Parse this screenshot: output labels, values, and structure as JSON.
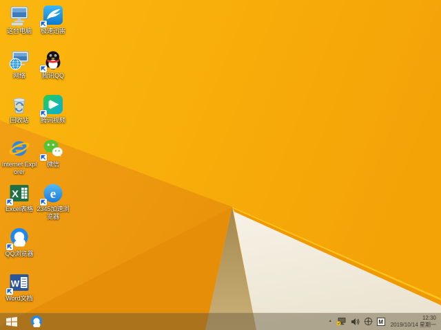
{
  "wallpaper": {
    "base_color": "#F8AF0B",
    "fold_mid_orange": "#F0990C",
    "fold_dark_orange": "#E78E08",
    "tan_triangle_top": "#A3874E",
    "tan_triangle_bottom": "#CBB179",
    "white_triangle_top": "#F7F2E6",
    "white_triangle_bottom": "#EBE4D2",
    "fold_edge_highlight": "#FFC41D",
    "fold_edge_shadow": "#EF9903"
  },
  "desktop": {
    "icons": [
      {
        "id": "this-pc",
        "label": "这台电脑",
        "shortcut_arrow": false
      },
      {
        "id": "xunlei-thunder",
        "label": "极速迅雷",
        "shortcut_arrow": true
      },
      {
        "id": "network",
        "label": "网络",
        "shortcut_arrow": false
      },
      {
        "id": "tencent-qq",
        "label": "腾讯QQ",
        "shortcut_arrow": true
      },
      {
        "id": "recycle-bin",
        "label": "回收站",
        "shortcut_arrow": false
      },
      {
        "id": "tencent-video",
        "label": "腾讯视频",
        "shortcut_arrow": true
      },
      {
        "id": "internet-explorer",
        "label": "Internet Explorer",
        "shortcut_arrow": false
      },
      {
        "id": "wechat",
        "label": "微信",
        "shortcut_arrow": true
      },
      {
        "id": "excel",
        "label": "Excel表格",
        "shortcut_arrow": true
      },
      {
        "id": "browser-2345",
        "label": "2345加速浏览器",
        "shortcut_arrow": true
      },
      {
        "id": "qq-browser",
        "label": "QQ浏览器",
        "shortcut_arrow": true
      },
      {
        "id": "word",
        "label": "Word文档",
        "shortcut_arrow": true
      }
    ]
  },
  "taskbar": {
    "start_button": {
      "icon": "windows-logo"
    },
    "pinned": [
      {
        "id": "qq-browser-taskbar",
        "icon": "qq-browser-logo"
      }
    ],
    "tray": {
      "expander_icon": "chevron-up",
      "icons": [
        "network-status-icon",
        "volume-icon",
        "crosshair-utility-icon",
        "input-method-indicator"
      ],
      "input_method": "M",
      "clock": {
        "time": "12:30",
        "date": "2019/10/14 星期一"
      }
    }
  }
}
